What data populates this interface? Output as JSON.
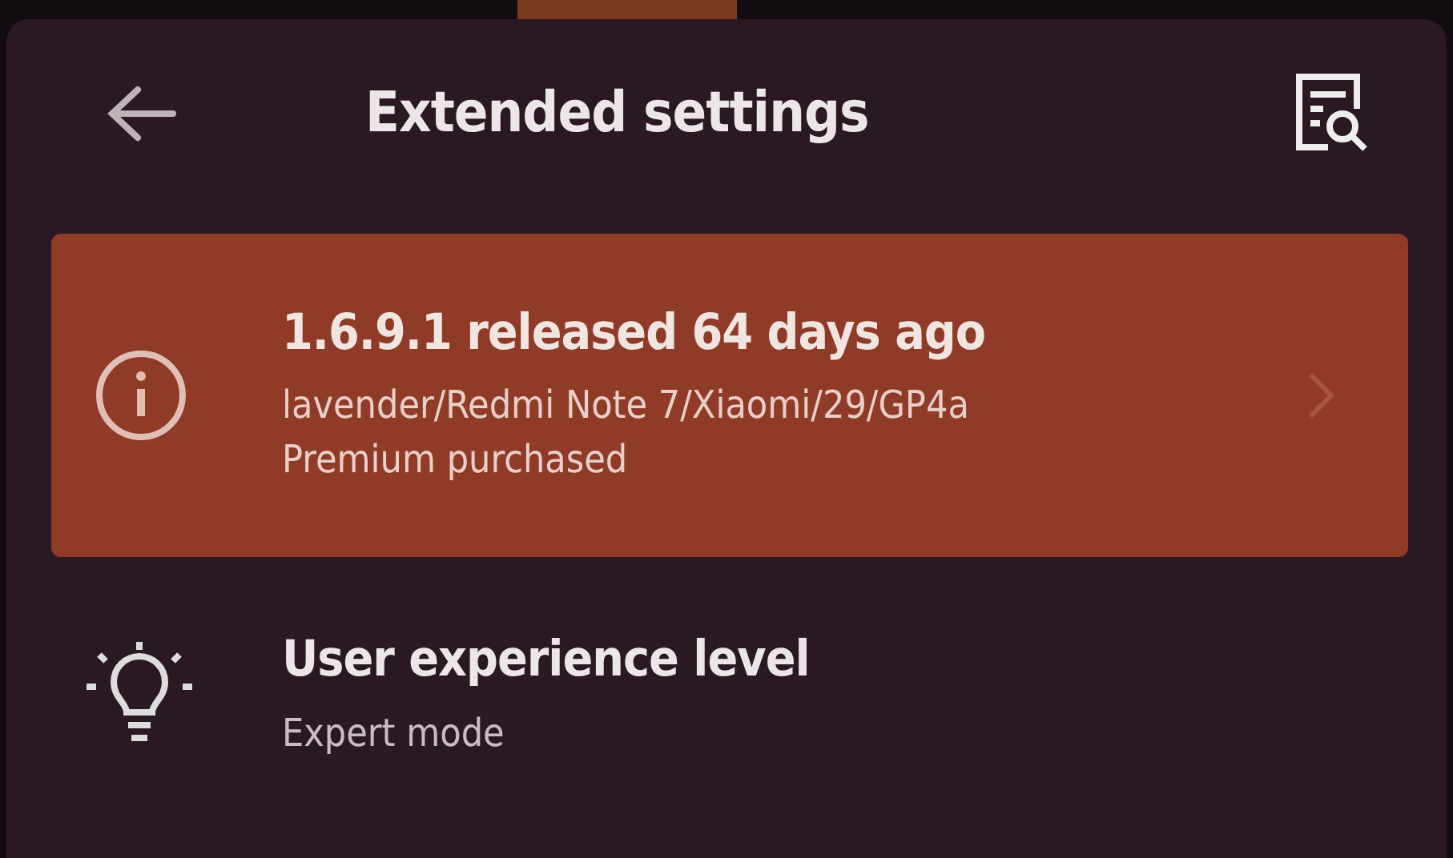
{
  "header": {
    "title": "Extended settings"
  },
  "banner": {
    "title": "1.6.9.1 released 64 days ago",
    "lines": [
      "lavender/Redmi Note 7/Xiaomi/29/GP4a",
      "Premium purchased"
    ]
  },
  "items": [
    {
      "title": "User experience level",
      "subtitle": "Expert mode"
    }
  ]
}
